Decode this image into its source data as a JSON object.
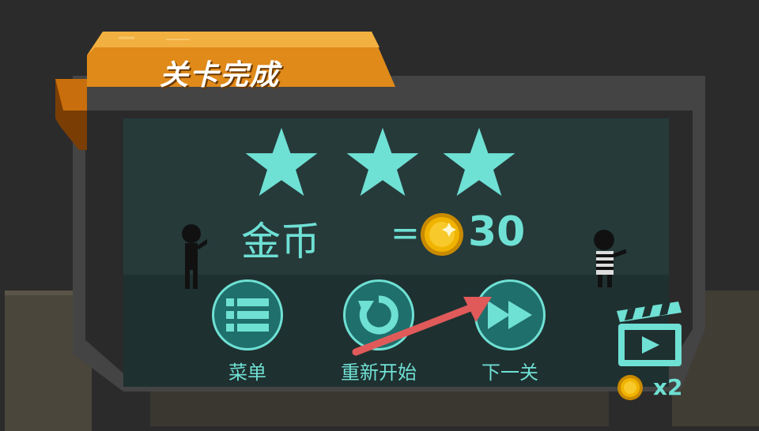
{
  "banner": {
    "title": "关卡完成"
  },
  "stars": {
    "earned": 3,
    "total": 3
  },
  "reward": {
    "label": "金币",
    "equals": "=",
    "amount": "30"
  },
  "buttons": {
    "menu": {
      "label": "菜单",
      "icon": "list-icon"
    },
    "restart": {
      "label": "重新开始",
      "icon": "restart-icon"
    },
    "next": {
      "label": "下一关",
      "icon": "fast-forward-icon"
    }
  },
  "video_bonus": {
    "icon": "video-clapper-icon",
    "multiplier": "x2"
  },
  "colors": {
    "accent": "#6fe0d4",
    "button_fill": "#1f6f6c",
    "banner": "#e08a1a",
    "panel": "#263a3a",
    "arrow": "#e05a5a",
    "coin": "#f0b400"
  }
}
